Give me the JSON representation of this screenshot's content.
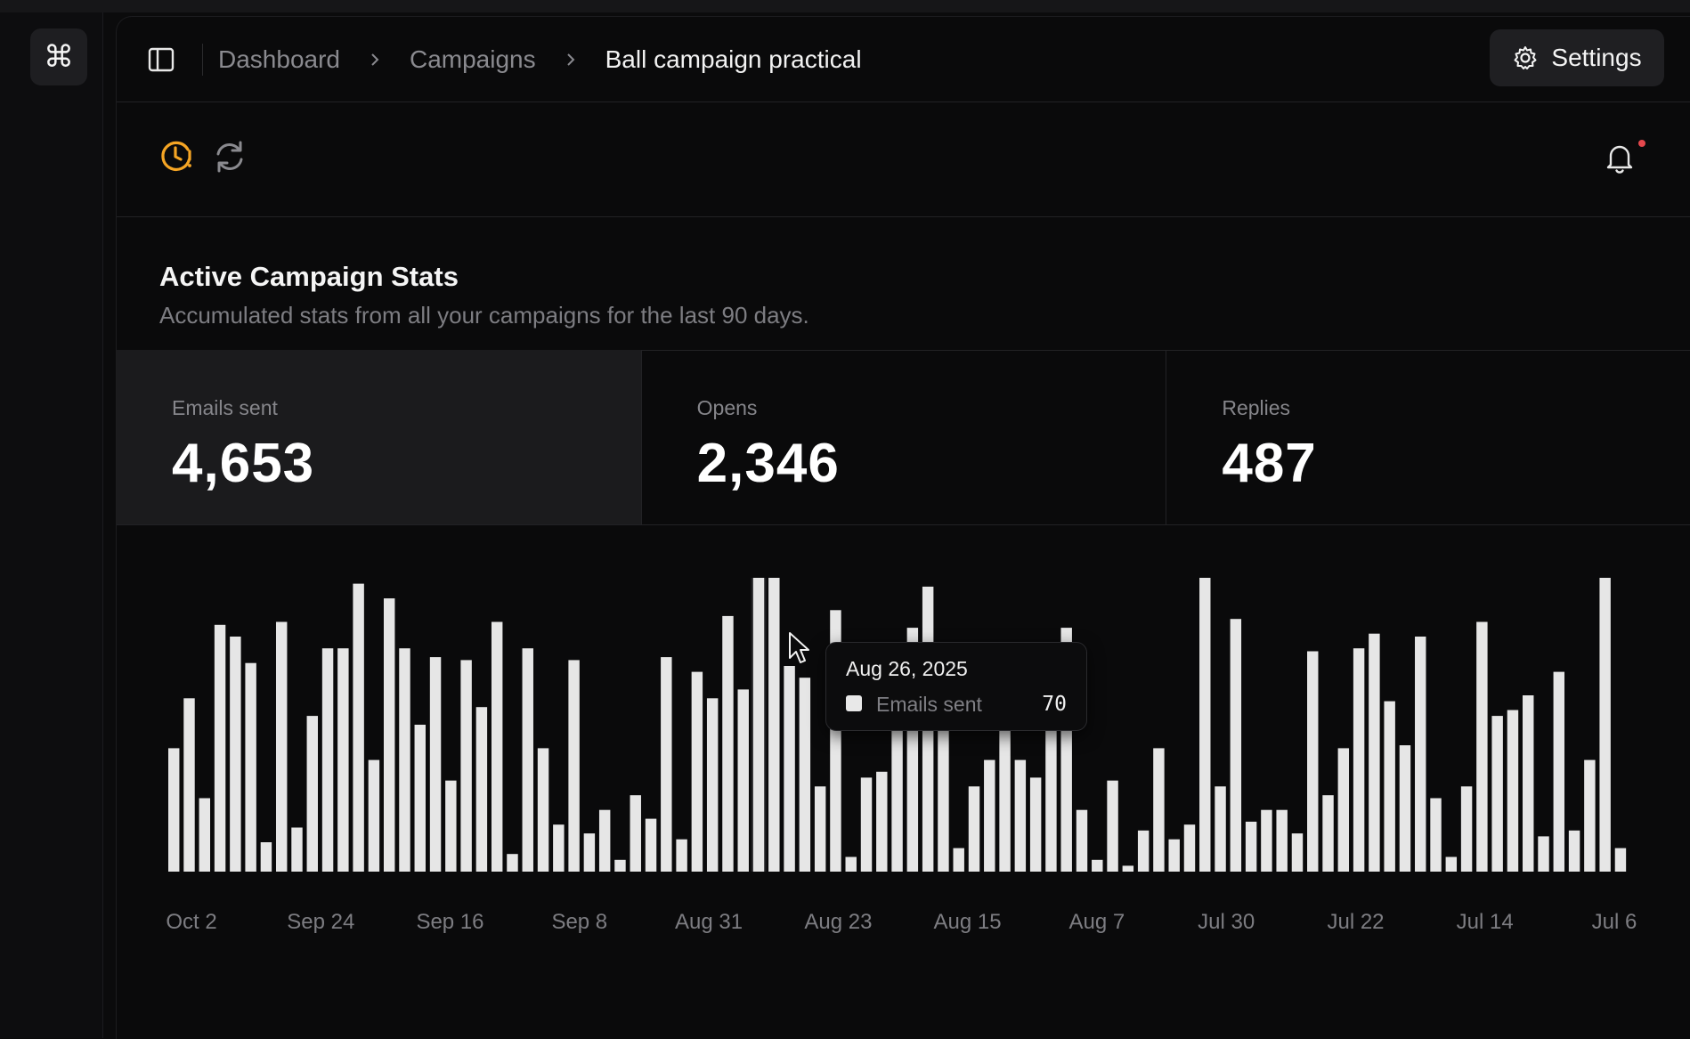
{
  "app": {
    "logo_glyph": "⌘"
  },
  "breadcrumb": {
    "items": [
      "Dashboard",
      "Campaigns",
      "Ball campaign practical"
    ]
  },
  "header": {
    "settings_label": "Settings"
  },
  "toolbar": {
    "schedule_icon_color": "#f5a524",
    "refresh_icon_color": "#8a8a8f"
  },
  "section": {
    "title": "Active Campaign Stats",
    "subtitle": "Accumulated stats from all your campaigns for the last 90 days."
  },
  "stats": [
    {
      "label": "Emails sent",
      "value": "4,653",
      "active": true
    },
    {
      "label": "Opens",
      "value": "2,346",
      "active": false
    },
    {
      "label": "Replies",
      "value": "487",
      "active": false
    }
  ],
  "tooltip": {
    "date": "Aug 26, 2025",
    "series": "Emails sent",
    "value": "70"
  },
  "chart_data": {
    "type": "bar",
    "series": [
      {
        "name": "Emails sent"
      }
    ],
    "highlighted_index": 38,
    "bar_color": "#e6e6e6",
    "highlight_color": "#1e1e21",
    "ylim": [
      0,
      100
    ],
    "x_tick_labels": [
      "Oct 2",
      "Sep 24",
      "Sep 16",
      "Sep 8",
      "Aug 31",
      "Aug 23",
      "Aug 15",
      "Aug 7",
      "Jul 30",
      "Jul 22",
      "Jul 14",
      "Jul 6"
    ],
    "values": [
      42,
      59,
      25,
      84,
      80,
      71,
      10,
      85,
      15,
      53,
      76,
      76,
      98,
      38,
      93,
      76,
      50,
      73,
      31,
      72,
      56,
      85,
      6,
      76,
      42,
      16,
      72,
      13,
      21,
      4,
      26,
      18,
      73,
      11,
      68,
      59,
      87,
      62,
      100,
      100,
      70,
      66,
      29,
      89,
      5,
      32,
      34,
      70,
      83,
      97,
      69,
      8,
      29,
      38,
      51,
      38,
      32,
      76,
      83,
      21,
      4,
      31,
      2,
      14,
      42,
      11,
      16,
      100,
      29,
      86,
      17,
      21,
      21,
      13,
      75,
      26,
      42,
      76,
      81,
      58,
      43,
      80,
      25,
      5,
      29,
      85,
      53,
      55,
      60,
      12,
      68,
      14,
      38,
      100,
      8
    ]
  }
}
